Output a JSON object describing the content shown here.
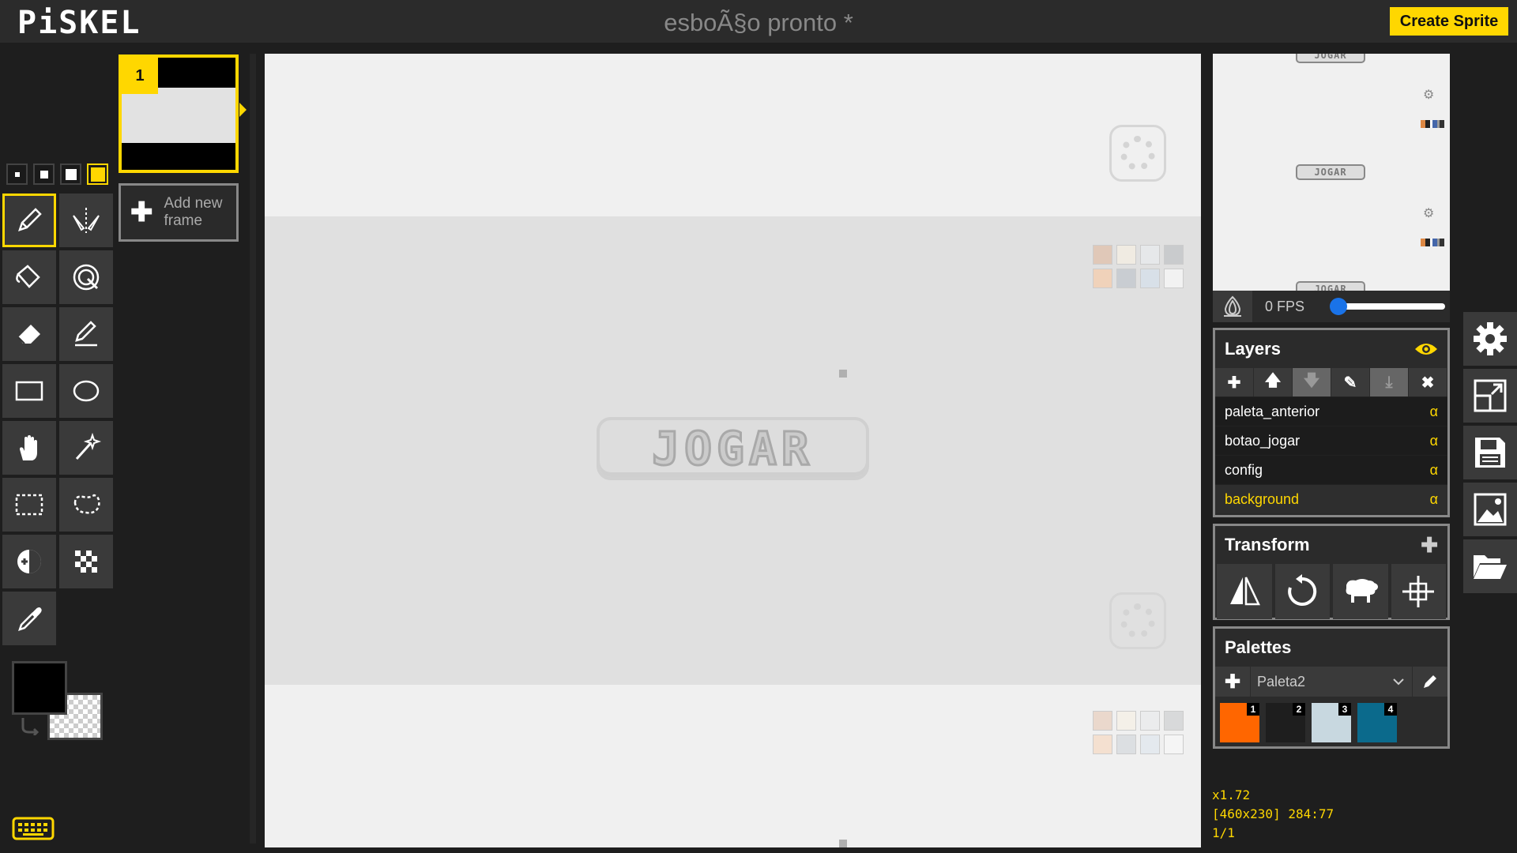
{
  "header": {
    "logo": "PiSKEL",
    "title": "esboÃ§o pronto *",
    "create_sprite": "Create Sprite"
  },
  "frames": {
    "frame_number": "1",
    "add_frame_label": "Add new frame"
  },
  "canvas": {
    "button_text": "JOGAR"
  },
  "preview": {
    "mini_button_text": "JOGAR",
    "fps_label": "0 FPS",
    "fps_value": 0
  },
  "layers": {
    "title": "Layers",
    "items": [
      {
        "name": "paleta_anterior",
        "alpha": "α"
      },
      {
        "name": "botao_jogar",
        "alpha": "α"
      },
      {
        "name": "config",
        "alpha": "α"
      },
      {
        "name": "background",
        "alpha": "α",
        "selected": true
      }
    ]
  },
  "transform": {
    "title": "Transform"
  },
  "palettes": {
    "title": "Palettes",
    "selected": "Paleta2",
    "colors": [
      {
        "num": "1",
        "hex": "#ff6600"
      },
      {
        "num": "2",
        "hex": "#1e1e1e"
      },
      {
        "num": "3",
        "hex": "#c8d8e0"
      },
      {
        "num": "4",
        "hex": "#0b6a8c"
      }
    ]
  },
  "status": {
    "zoom": "x1.72",
    "size_cursor": "[460x230] 284:77",
    "frame": "1/1"
  },
  "colors": {
    "accent": "#ffd700",
    "primary": "#000000",
    "secondary": "transparent"
  }
}
